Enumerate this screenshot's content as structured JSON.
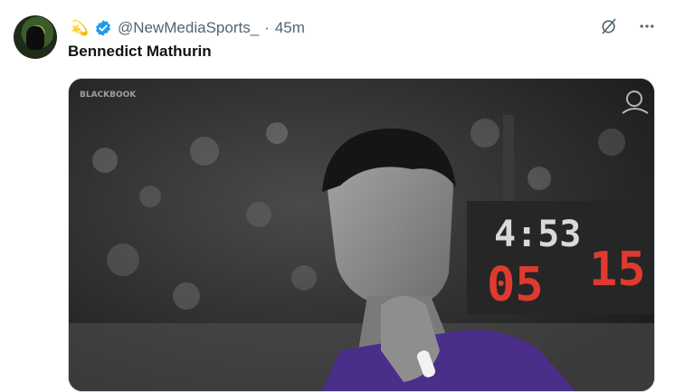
{
  "tweet": {
    "handle": "@NewMediaSports_",
    "separator": "·",
    "time": "45m",
    "text": "Bennedict Mathurin"
  },
  "badge_emoji": "💫",
  "icons": {
    "verified": "verified-badge-icon",
    "grok": "grok-icon",
    "more": "more-options-icon"
  },
  "media": {
    "scoreboard_clock": "4:53",
    "score_left": "05",
    "score_right": "15",
    "watermark": "BLACKBOOK"
  },
  "colors": {
    "handle_gray": "#536471",
    "verified_blue": "#1d9bf0",
    "scoreboard_red": "#e03a2f",
    "jersey_purple": "#4b2d8a"
  }
}
